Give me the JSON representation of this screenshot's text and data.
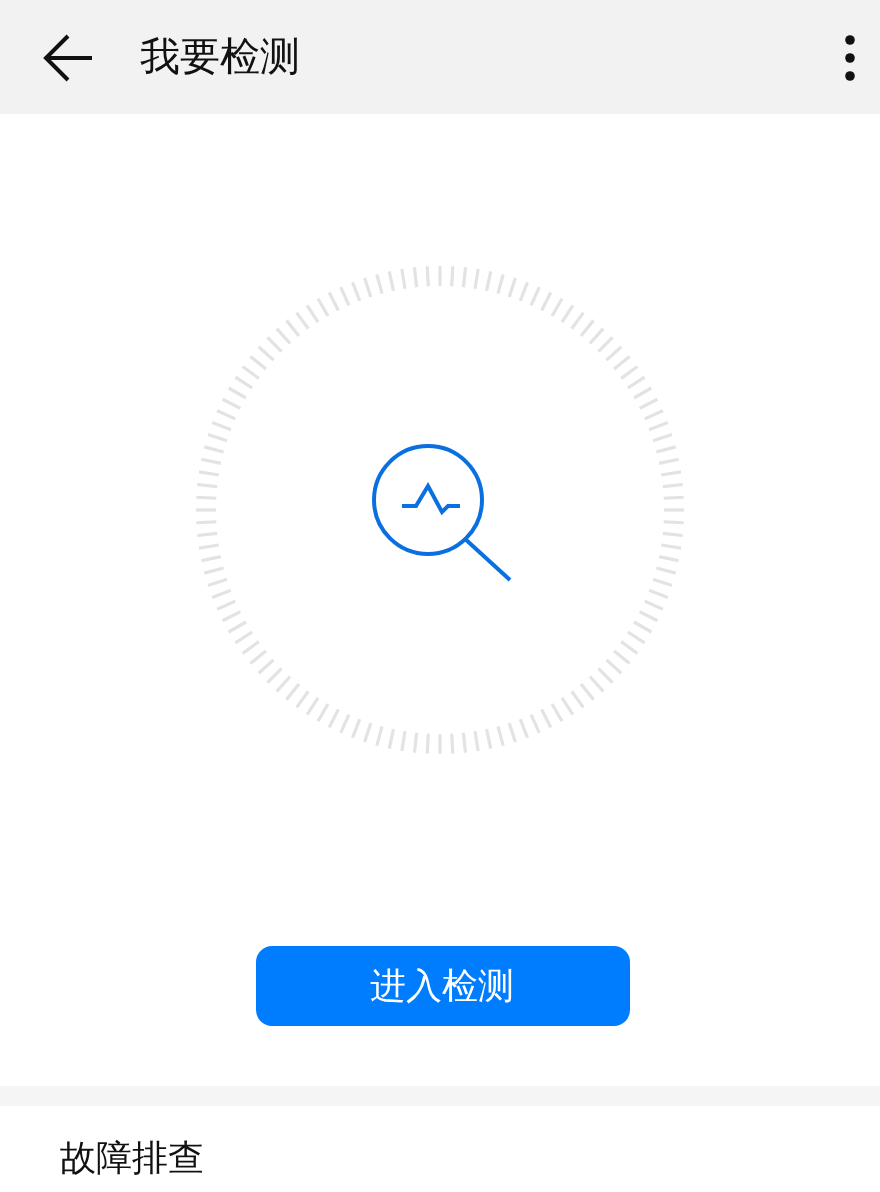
{
  "header": {
    "title": "我要检测"
  },
  "action_button": {
    "label": "进入检测"
  },
  "list": [
    {
      "label": "故障排查"
    }
  ]
}
